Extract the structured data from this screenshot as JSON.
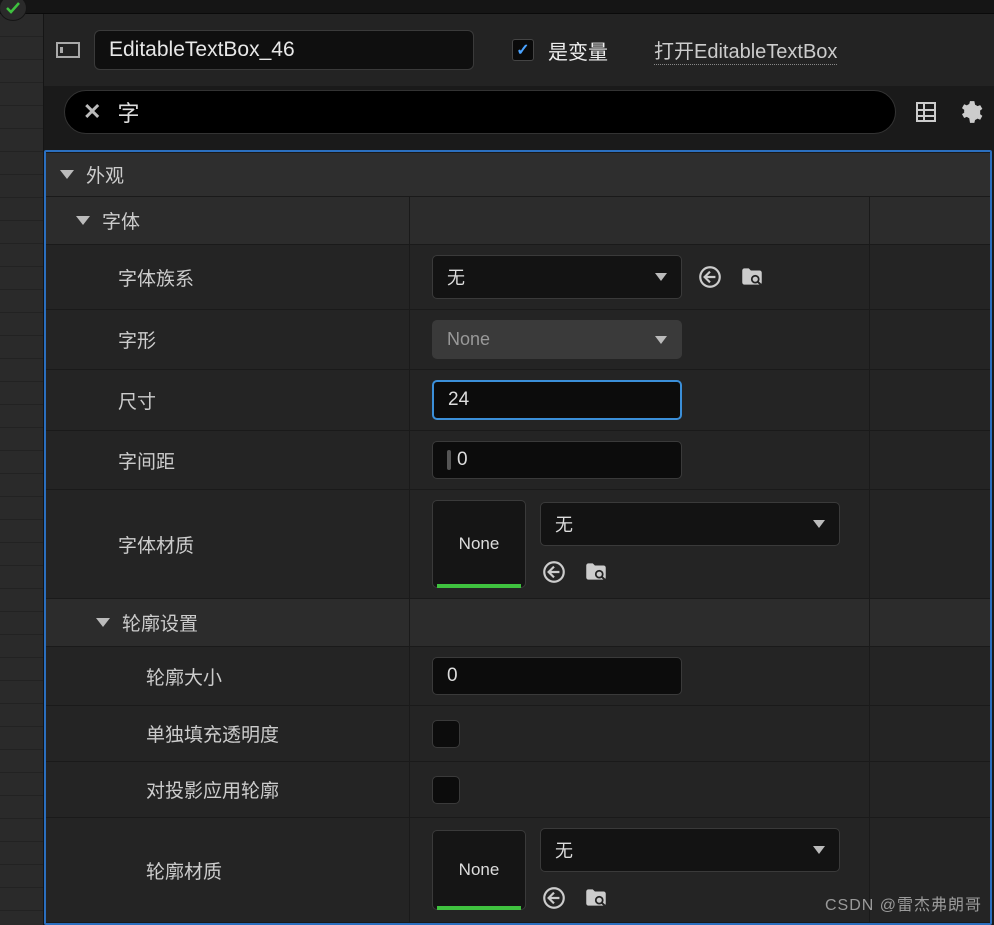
{
  "header": {
    "widget_name": "EditableTextBox_46",
    "is_variable_label": "是变量",
    "is_variable_checked": true,
    "open_link": "打开EditableTextBox"
  },
  "search": {
    "value": "字",
    "clear_icon": "close"
  },
  "sections": {
    "appearance": {
      "label": "外观"
    },
    "font": {
      "label": "字体",
      "props": {
        "family": {
          "label": "字体族系",
          "value": "无"
        },
        "typeface": {
          "label": "字形",
          "value": "None"
        },
        "size": {
          "label": "尺寸",
          "value": "24"
        },
        "spacing": {
          "label": "字间距",
          "value": "0"
        },
        "material": {
          "label": "字体材质",
          "thumb": "None",
          "value": "无"
        }
      }
    },
    "outline": {
      "label": "轮廓设置",
      "props": {
        "size": {
          "label": "轮廓大小",
          "value": "0"
        },
        "fill_alpha": {
          "label": "单独填充透明度"
        },
        "shadow_outline": {
          "label": "对投影应用轮廓"
        },
        "material": {
          "label": "轮廓材质",
          "thumb": "None",
          "value": "无"
        }
      }
    }
  },
  "watermark": "CSDN @雷杰弗朗哥"
}
